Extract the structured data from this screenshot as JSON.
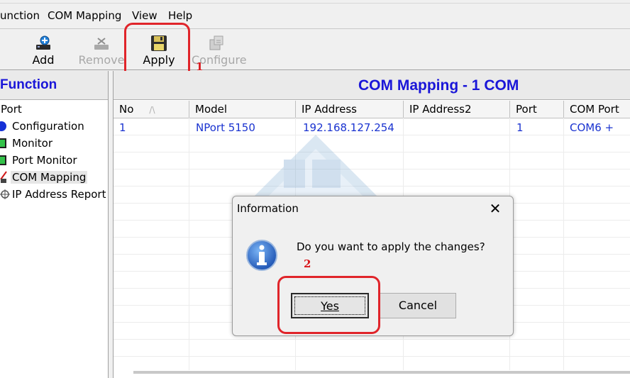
{
  "menu": {
    "items": [
      "unction",
      "COM Mapping",
      "View",
      "Help"
    ]
  },
  "toolbar": {
    "add_label": "Add",
    "remove_label": "Remove",
    "apply_label": "Apply",
    "configure_label": "Configure"
  },
  "annotations": {
    "step1": "1",
    "step2": "2",
    "highlight_color": "#e0242a"
  },
  "sidebar": {
    "title": "Function",
    "items": [
      {
        "label": "Port",
        "icon": "none"
      },
      {
        "label": "Configuration",
        "icon": "blue-circle-icon"
      },
      {
        "label": "Monitor",
        "icon": "monitor-icon"
      },
      {
        "label": "Port Monitor",
        "icon": "port-monitor-icon"
      },
      {
        "label": "COM Mapping",
        "icon": "com-mapping-icon"
      },
      {
        "label": "IP Address Report",
        "icon": "ip-report-icon"
      }
    ]
  },
  "main": {
    "title": "COM Mapping - 1 COM",
    "title_color": "#1a16d8",
    "columns": [
      "No",
      "Model",
      "IP Address",
      "IP Address2",
      "Port",
      "COM Port"
    ],
    "sort_mark": "/\\",
    "rows": [
      {
        "no": "1",
        "model": "NPort 5150",
        "ip": "192.168.127.254",
        "ip2": "",
        "port": "1",
        "com_port": "COM6 +"
      }
    ],
    "row_text_color": "#1a33d0"
  },
  "dialog": {
    "title": "Information",
    "close_symbol": "✕",
    "message": "Do you want to apply the changes?",
    "yes_label": "Yes",
    "cancel_label": "Cancel",
    "icon": "info-icon"
  }
}
